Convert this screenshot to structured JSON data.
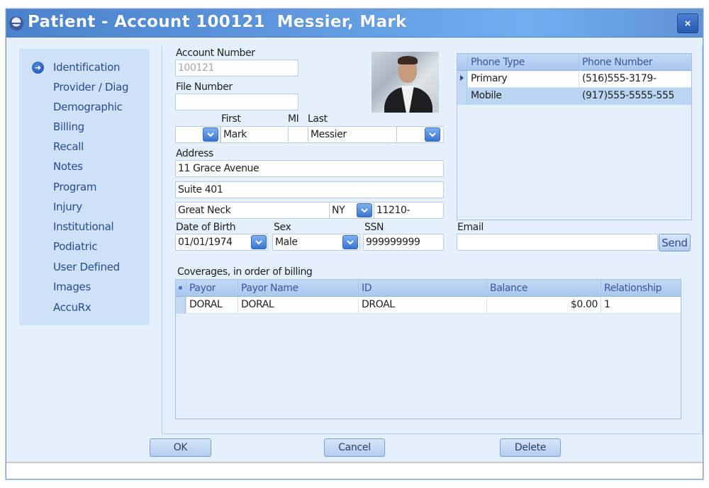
{
  "window": {
    "title": "Patient - Account 100121  Messier, Mark",
    "close_label": "×"
  },
  "sidebar": {
    "items": [
      {
        "label": "Identification",
        "active": true
      },
      {
        "label": "Provider / Diag"
      },
      {
        "label": "Demographic"
      },
      {
        "label": "Billing"
      },
      {
        "label": "Recall"
      },
      {
        "label": "Notes"
      },
      {
        "label": "Program"
      },
      {
        "label": "Injury"
      },
      {
        "label": "Institutional"
      },
      {
        "label": "Podiatric"
      },
      {
        "label": "User Defined"
      },
      {
        "label": "Images"
      },
      {
        "label": "AccuRx"
      }
    ]
  },
  "form": {
    "account_number_label": "Account Number",
    "account_number": "100121",
    "file_number_label": "File Number",
    "file_number": "",
    "first_label": "First",
    "mi_label": "MI",
    "last_label": "Last",
    "prefix": "",
    "first": "Mark",
    "mi": "",
    "last": "Messier",
    "suffix": "",
    "address_label": "Address",
    "address1": "11 Grace Avenue",
    "address2": "Suite 401",
    "city": "Great Neck",
    "state": "NY",
    "zip": "11210-",
    "dob_label": "Date of Birth",
    "dob": "01/01/1974",
    "sex_label": "Sex",
    "sex": "Male",
    "ssn_label": "SSN",
    "ssn": "999999999",
    "email_label": "Email",
    "email": "",
    "send_label": "Send"
  },
  "phones": {
    "columns": [
      "Phone Type",
      "Phone Number"
    ],
    "rows": [
      {
        "type": "Primary",
        "number": "(516)555-3179-",
        "current": true
      },
      {
        "type": "Mobile",
        "number": "(917)555-5555-555",
        "selected": true
      }
    ]
  },
  "coverages": {
    "label": "Coverages, in order of billing",
    "columns": [
      "Payor",
      "Payor Name",
      "ID",
      "Balance",
      "Relationship"
    ],
    "rows": [
      {
        "payor": "DORAL",
        "payor_name": "DORAL",
        "id": "DROAL",
        "balance": "$0.00",
        "relationship": "1"
      }
    ]
  },
  "buttons": {
    "ok": "OK",
    "cancel": "Cancel",
    "delete": "Delete"
  },
  "colors": {
    "title_bar": "#5e97dd",
    "background": "#e4f0fc",
    "sidebar": "#cde1f7",
    "nav_text": "#2b4a93",
    "grid_header": "#a9c8ee"
  }
}
